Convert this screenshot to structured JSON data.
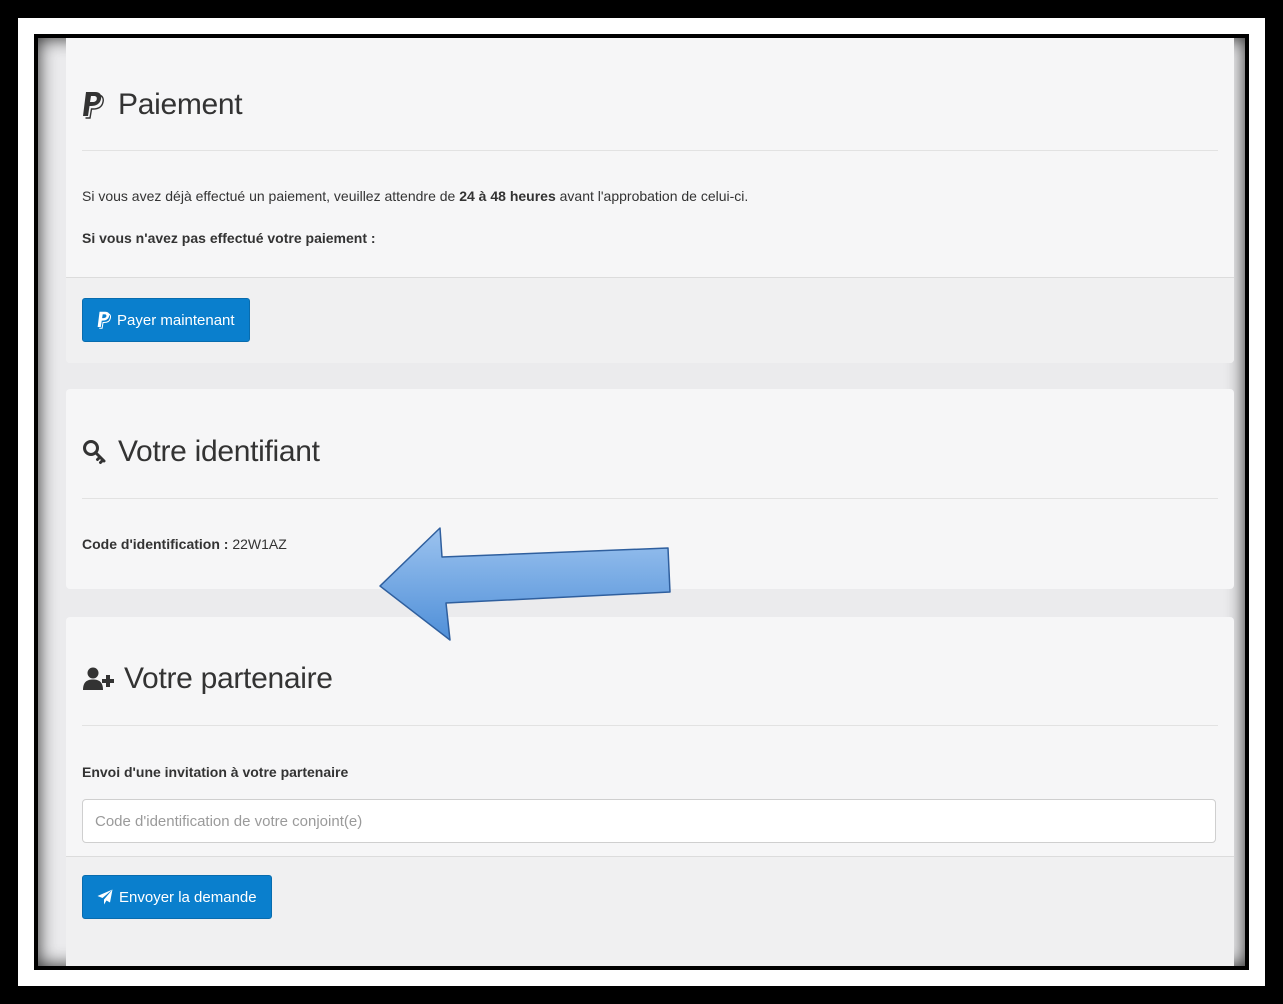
{
  "payment": {
    "title": "Paiement",
    "info_prefix": "Si vous avez déjà effectué un paiement, veuillez attendre de ",
    "info_bold": "24 à 48 heures",
    "info_suffix": " avant l'approbation de celui-ci.",
    "not_paid": "Si vous n'avez pas effectué votre paiement :",
    "pay_button": "Payer maintenant"
  },
  "identifier": {
    "title": "Votre identifiant",
    "code_label": "Code d'identification :",
    "code_value": "22W1AZ"
  },
  "partner": {
    "title": "Votre partenaire",
    "invite_label": "Envoi d'une invitation à votre partenaire",
    "input_placeholder": "Code d'identification de votre conjoint(e)",
    "send_button": "Envoyer la demande"
  },
  "colors": {
    "primary_button": "#0a7fcd",
    "annotation_arrow": "#6fa3e0"
  }
}
